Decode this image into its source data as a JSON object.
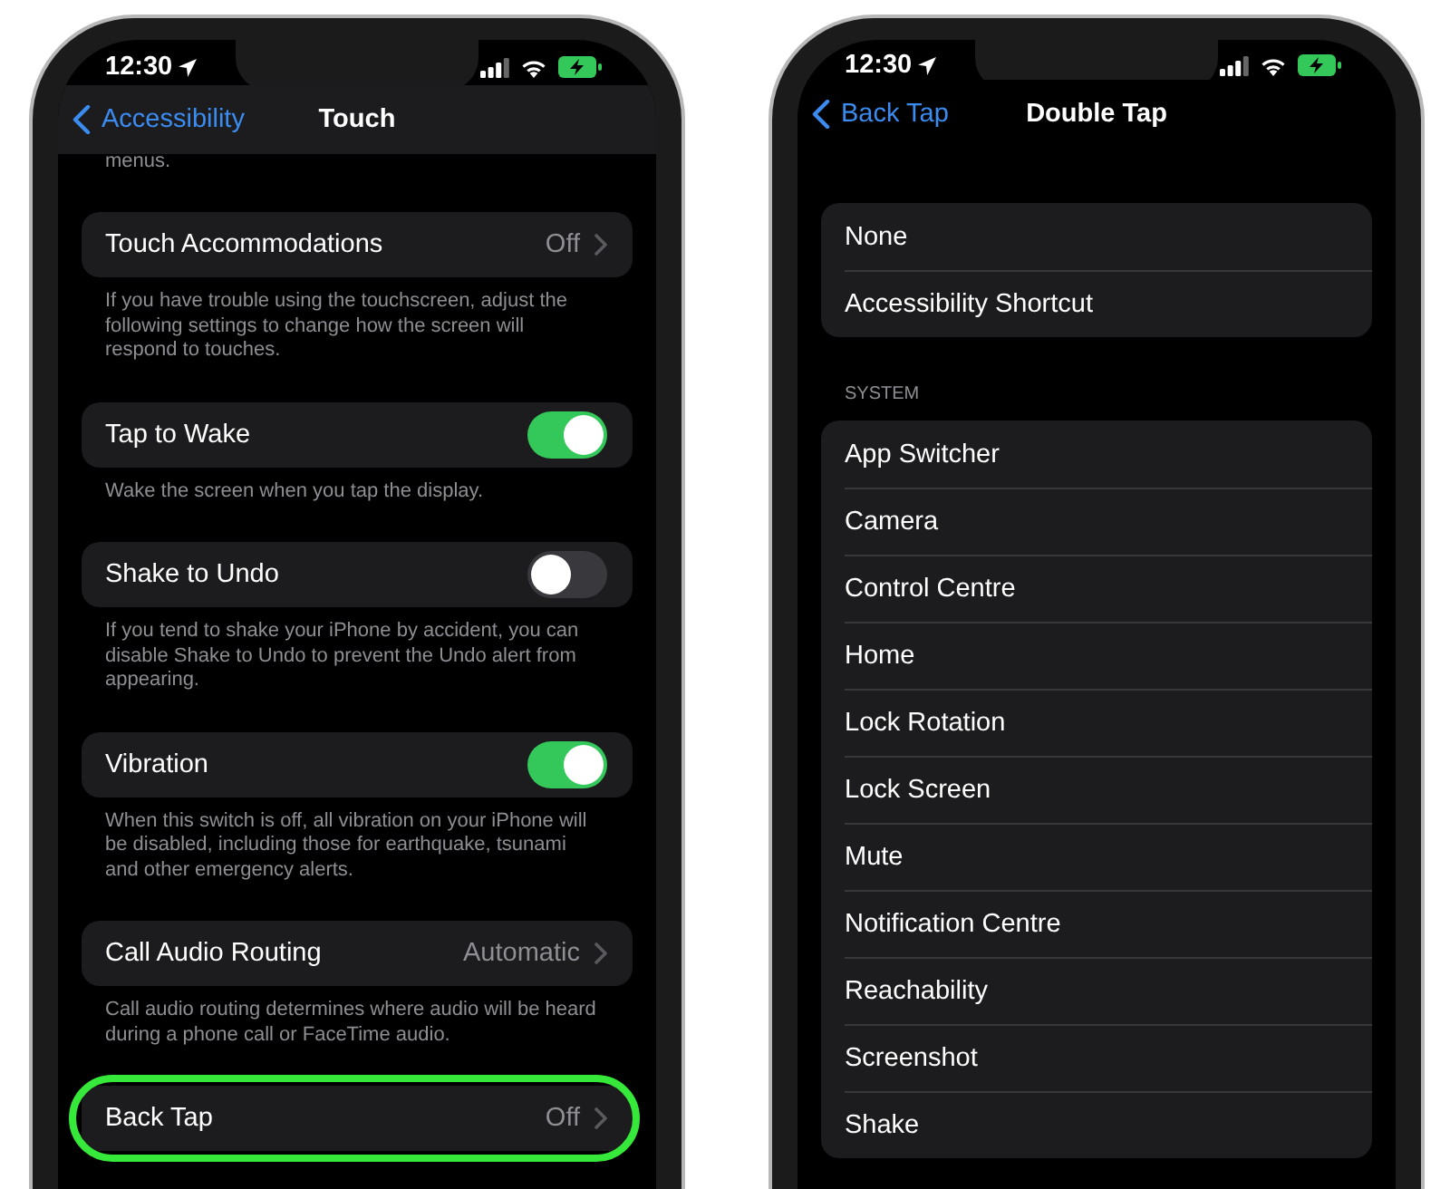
{
  "phones": [
    {
      "status": {
        "time": "12:30"
      },
      "nav": {
        "back": "Accessibility",
        "title": "Touch",
        "translucent": true
      },
      "lead_text": "menus.",
      "groups": [
        {
          "rows": [
            {
              "kind": "value",
              "label": "Touch Accommodations",
              "value": "Off",
              "highlighted": false
            }
          ],
          "footer": "If you have trouble using the touchscreen, adjust the following settings to change how the screen will respond to touches."
        },
        {
          "rows": [
            {
              "kind": "toggle",
              "label": "Tap to Wake",
              "on": true,
              "highlighted": false
            }
          ],
          "footer": "Wake the screen when you tap the display."
        },
        {
          "rows": [
            {
              "kind": "toggle",
              "label": "Shake to Undo",
              "on": false,
              "highlighted": false
            }
          ],
          "footer": "If you tend to shake your iPhone by accident, you can disable Shake to Undo to prevent the Undo alert from appearing."
        },
        {
          "rows": [
            {
              "kind": "toggle",
              "label": "Vibration",
              "on": true,
              "highlighted": false
            }
          ],
          "footer": "When this switch is off, all vibration on your iPhone will be disabled, including those for earthquake, tsunami and other emergency alerts."
        },
        {
          "rows": [
            {
              "kind": "value",
              "label": "Call Audio Routing",
              "value": "Automatic",
              "highlighted": false
            }
          ],
          "footer": "Call audio routing determines where audio will be heard during a phone call or FaceTime audio."
        },
        {
          "rows": [
            {
              "kind": "value",
              "label": "Back Tap",
              "value": "Off",
              "highlighted": true
            }
          ]
        }
      ]
    },
    {
      "status": {
        "time": "12:30"
      },
      "nav": {
        "back": "Back Tap",
        "title": "Double Tap",
        "translucent": false
      },
      "groups": [
        {
          "rows": [
            {
              "kind": "plain",
              "label": "None"
            },
            {
              "kind": "plain",
              "label": "Accessibility Shortcut"
            }
          ]
        },
        {
          "header": "SYSTEM",
          "rows": [
            {
              "kind": "plain",
              "label": "App Switcher"
            },
            {
              "kind": "plain",
              "label": "Camera"
            },
            {
              "kind": "plain",
              "label": "Control Centre"
            },
            {
              "kind": "plain",
              "label": "Home"
            },
            {
              "kind": "plain",
              "label": "Lock Rotation"
            },
            {
              "kind": "plain",
              "label": "Lock Screen"
            },
            {
              "kind": "plain",
              "label": "Mute"
            },
            {
              "kind": "plain",
              "label": "Notification Centre"
            },
            {
              "kind": "plain",
              "label": "Reachability"
            },
            {
              "kind": "plain",
              "label": "Screenshot"
            },
            {
              "kind": "plain",
              "label": "Shake"
            }
          ]
        }
      ]
    }
  ]
}
